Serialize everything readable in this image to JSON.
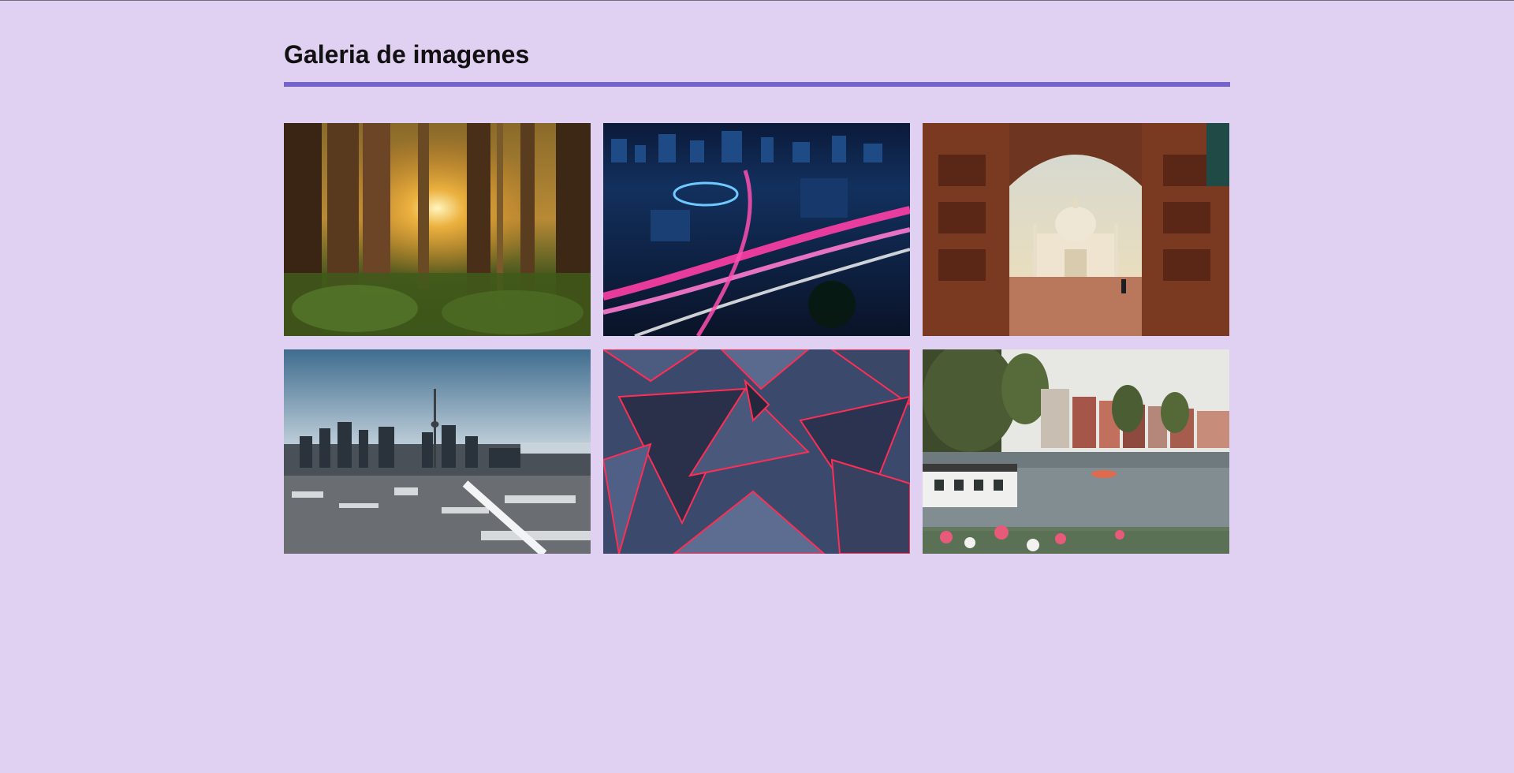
{
  "page": {
    "title": "Galeria de imagenes",
    "background": "#e0d0f1",
    "accent": "#7563cb"
  },
  "gallery": {
    "images": [
      {
        "subject": "forest-sunlight-photo"
      },
      {
        "subject": "city-night-light-trails-photo"
      },
      {
        "subject": "taj-mahal-archway-photo"
      },
      {
        "subject": "toronto-skyline-winter-photo"
      },
      {
        "subject": "abstract-3d-triangles-photo"
      },
      {
        "subject": "amsterdam-canal-photo"
      }
    ]
  }
}
